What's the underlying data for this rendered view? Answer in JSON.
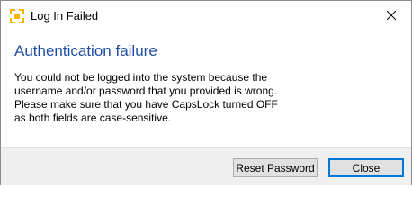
{
  "window": {
    "title": "Log In Failed",
    "app_icon": "app-logo-icon",
    "close_icon": "close-icon"
  },
  "dialog": {
    "heading": "Authentication failure",
    "message_lines": [
      "You could not be logged into the system because the",
      "username and/or password that you provided is wrong.",
      "Please make sure that you have CapsLock turned OFF",
      "as both fields are case-sensitive."
    ]
  },
  "buttons": {
    "reset_password_label": "Reset Password",
    "close_label": "Close"
  },
  "colors": {
    "heading": "#1f4fa3",
    "icon_accent": "#f5b800",
    "default_button_border": "#0078d7",
    "footer_background": "#f0f0f0"
  }
}
